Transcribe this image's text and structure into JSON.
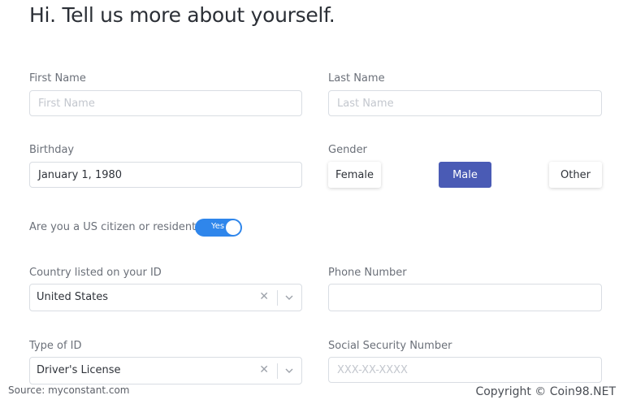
{
  "heading": "Hi. Tell us more about yourself.",
  "first_name": {
    "label": "First Name",
    "placeholder": "First Name"
  },
  "last_name": {
    "label": "Last Name",
    "placeholder": "Last Name"
  },
  "birthday": {
    "label": "Birthday",
    "value": "January 1, 1980"
  },
  "gender": {
    "label": "Gender",
    "options": [
      "Female",
      "Male",
      "Other"
    ],
    "selected": "Male"
  },
  "us_citizen": {
    "label": "Are you a US citizen or resident?",
    "toggle_text": "Yes",
    "checked": true
  },
  "country": {
    "label": "Country listed on your ID",
    "value": "United States"
  },
  "phone": {
    "label": "Phone Number",
    "value": ""
  },
  "id_type": {
    "label": "Type of ID",
    "value": "Driver's License"
  },
  "ssn": {
    "label": "Social Security Number",
    "placeholder": "XXX-XX-XXXX"
  },
  "footer": {
    "source": "Source: myconstant.com",
    "copyright": "Copyright © Coin98.NET"
  },
  "colors": {
    "accent": "#4a5bb5",
    "toggle": "#2f86eb",
    "border": "#d9dde3"
  },
  "icons": {
    "clear": "close-icon",
    "dropdown": "chevron-down-icon"
  }
}
